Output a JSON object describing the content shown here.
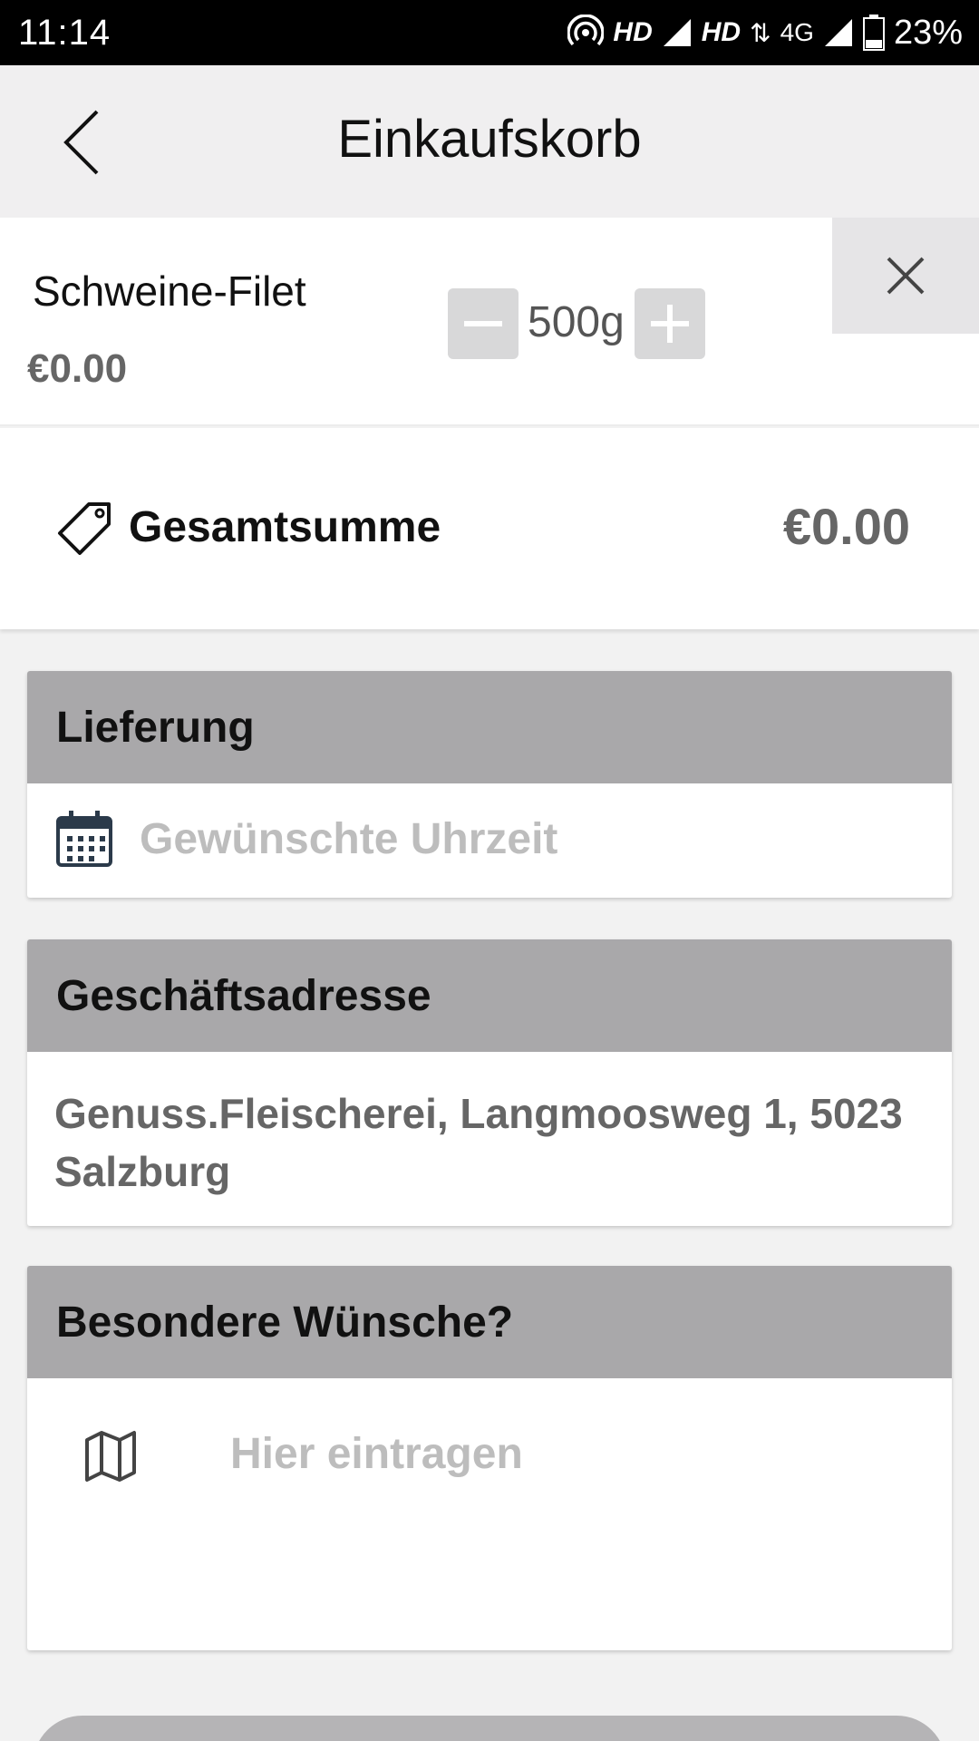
{
  "status_bar": {
    "time": "11:14",
    "hd1": "HD",
    "hd2": "HD",
    "network": "4G",
    "battery": "23%"
  },
  "header": {
    "title": "Einkaufskorb",
    "back_icon": "chevron-left-icon"
  },
  "cart_item": {
    "name": "Schweine-Filet",
    "price": "€0.00",
    "quantity": "500g",
    "minus_icon": "minus-icon",
    "plus_icon": "plus-icon",
    "remove_icon": "close-icon"
  },
  "total": {
    "label": "Gesamtsumme",
    "value": "€0.00",
    "icon": "tag-icon"
  },
  "delivery": {
    "header": "Lieferung",
    "placeholder": "Gewünschte Uhrzeit",
    "icon": "calendar-icon"
  },
  "address": {
    "header": "Geschäftsadresse",
    "text": "Genuss.Fleischerei, Langmoosweg 1, 5023 Salzburg"
  },
  "wishes": {
    "header": "Besondere Wünsche?",
    "placeholder": "Hier eintragen",
    "icon": "map-icon"
  },
  "colors": {
    "section_header_bg": "#a9a8aa",
    "appbar_bg": "#f0eff0",
    "muted_text": "#666666",
    "placeholder": "#bdbdbd"
  }
}
